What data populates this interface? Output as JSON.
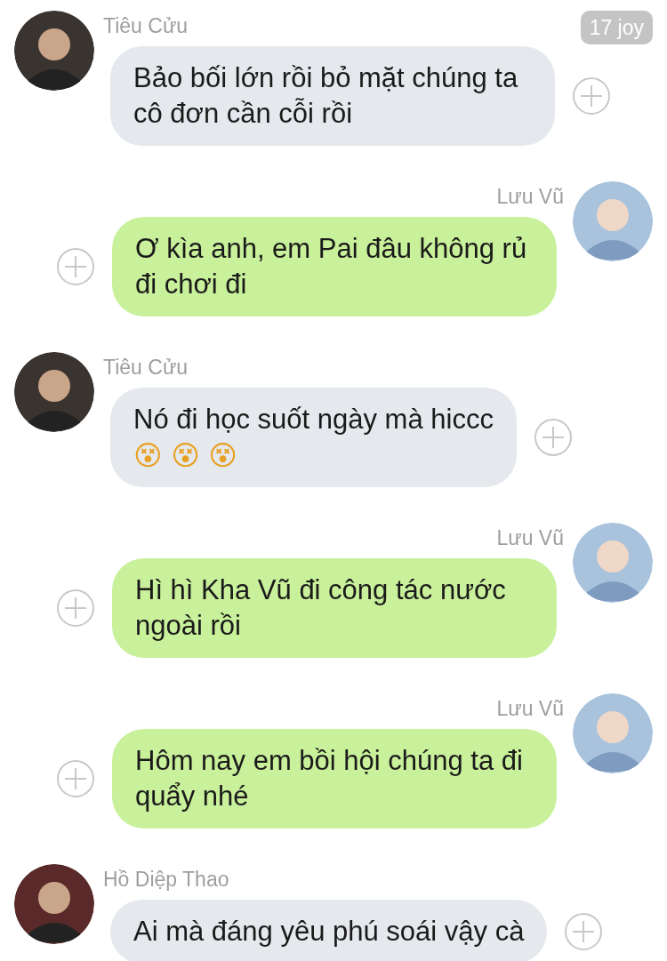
{
  "messages": [
    {
      "kind": "received",
      "sender": "Tiêu Cửu",
      "text": "Bảo bối lớn rồi bỏ mặt chúng ta cô đơn cần cỗi rồi",
      "badge": "17 joy"
    },
    {
      "kind": "sent",
      "sender": "Lưu Vũ",
      "text": "Ơ kìa anh, em Pai đâu không rủ đi chơi đi"
    },
    {
      "kind": "received",
      "sender": "Tiêu Cửu",
      "text": "Nó đi học suốt ngày mà hiccc",
      "emoji": "😵 😵 😵"
    },
    {
      "kind": "sent",
      "sender": "Lưu Vũ",
      "text": "Hì hì Kha Vũ đi công tác nước ngoài rồi"
    },
    {
      "kind": "sent",
      "sender": "Lưu Vũ",
      "text": "Hôm nay em bồi hội chúng ta đi quẩy nhé"
    },
    {
      "kind": "received",
      "sender": "Hồ Diệp Thao",
      "text": "Ai mà đáng yêu phú soái vậy cà"
    }
  ]
}
